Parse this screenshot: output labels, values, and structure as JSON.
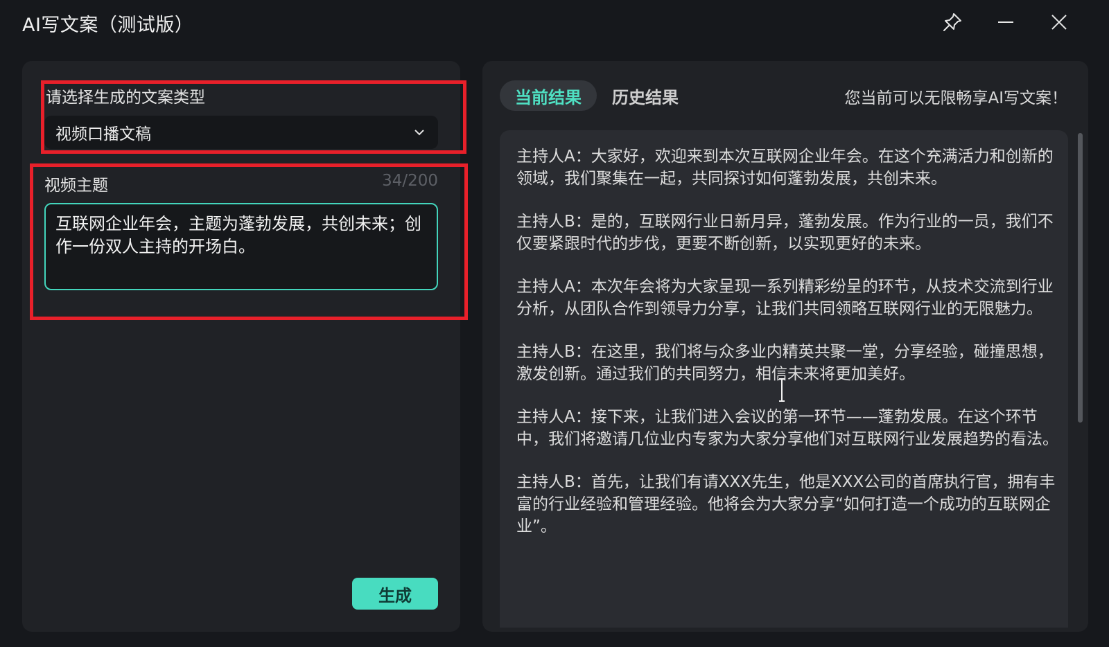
{
  "window": {
    "title": "AI写文案（测试版）",
    "icons": {
      "pin": "pin-icon",
      "minimize": "minimize-icon",
      "close": "close-icon"
    }
  },
  "left": {
    "type_label": "请选择生成的文案类型",
    "type_selected": "视频口播文稿",
    "topic_label": "视频主题",
    "topic_counter": "34/200",
    "topic_value": "互联网企业年会，主题为蓬勃发展，共创未来；创作一份双人主持的开场白。",
    "generate_label": "生成"
  },
  "right": {
    "tabs": [
      {
        "label": "当前结果",
        "active": true
      },
      {
        "label": "历史结果",
        "active": false
      }
    ],
    "promo": "您当前可以无限畅享AI写文案！",
    "paragraphs": [
      "主持人A：大家好，欢迎来到本次互联网企业年会。在这个充满活力和创新的领域，我们聚集在一起，共同探讨如何蓬勃发展，共创未来。",
      "主持人B：是的，互联网行业日新月异，蓬勃发展。作为行业的一员，我们不仅要紧跟时代的步伐，更要不断创新，以实现更好的未来。",
      "主持人A：本次年会将为大家呈现一系列精彩纷呈的环节，从技术交流到行业分析，从团队合作到领导力分享，让我们共同领略互联网行业的无限魅力。",
      "主持人B：在这里，我们将与众多业内精英共聚一堂，分享经验，碰撞思想，激发创新。通过我们的共同努力，相信未来将更加美好。",
      "主持人A：接下来，让我们进入会议的第一环节——蓬勃发展。在这个环节中，我们将邀请几位业内专家为大家分享他们对互联网行业发展趋势的看法。",
      "主持人B：首先，让我们有请XXX先生，他是XXX公司的首席执行官，拥有丰富的行业经验和管理经验。他将会为大家分享“如何打造一个成功的互联网企业”。"
    ]
  },
  "colors": {
    "accent": "#48dcc0",
    "highlight": "#e8202a",
    "background": "#16181c",
    "panel": "#202226"
  }
}
